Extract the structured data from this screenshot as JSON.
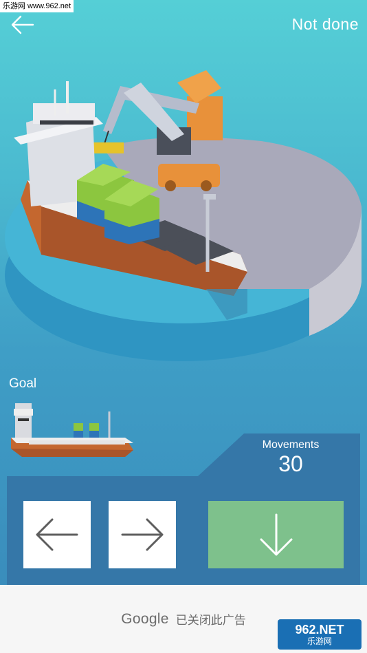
{
  "watermark": {
    "top_text": "乐游网 www.962.net",
    "logo_main": "962.NET",
    "logo_sub": "乐游网"
  },
  "header": {
    "back_icon": "arrow-left-icon",
    "status": "Not done"
  },
  "goal": {
    "label": "Goal"
  },
  "moves": {
    "label": "Movements",
    "value": "30"
  },
  "controls": {
    "left_icon": "arrow-left-icon",
    "right_icon": "arrow-right-icon",
    "drop_icon": "arrow-down-icon"
  },
  "ad": {
    "brand": "Google",
    "text": "已关闭此广告"
  },
  "colors": {
    "sky_top": "#55cfd6",
    "sky_bottom": "#3a8dbc",
    "panel": "#3577a8",
    "drop_button": "#7ec18c",
    "hull": "#c4672f",
    "container_green": "#8cc63f",
    "container_blue": "#2d74b8",
    "crane_orange": "#e8913a"
  }
}
